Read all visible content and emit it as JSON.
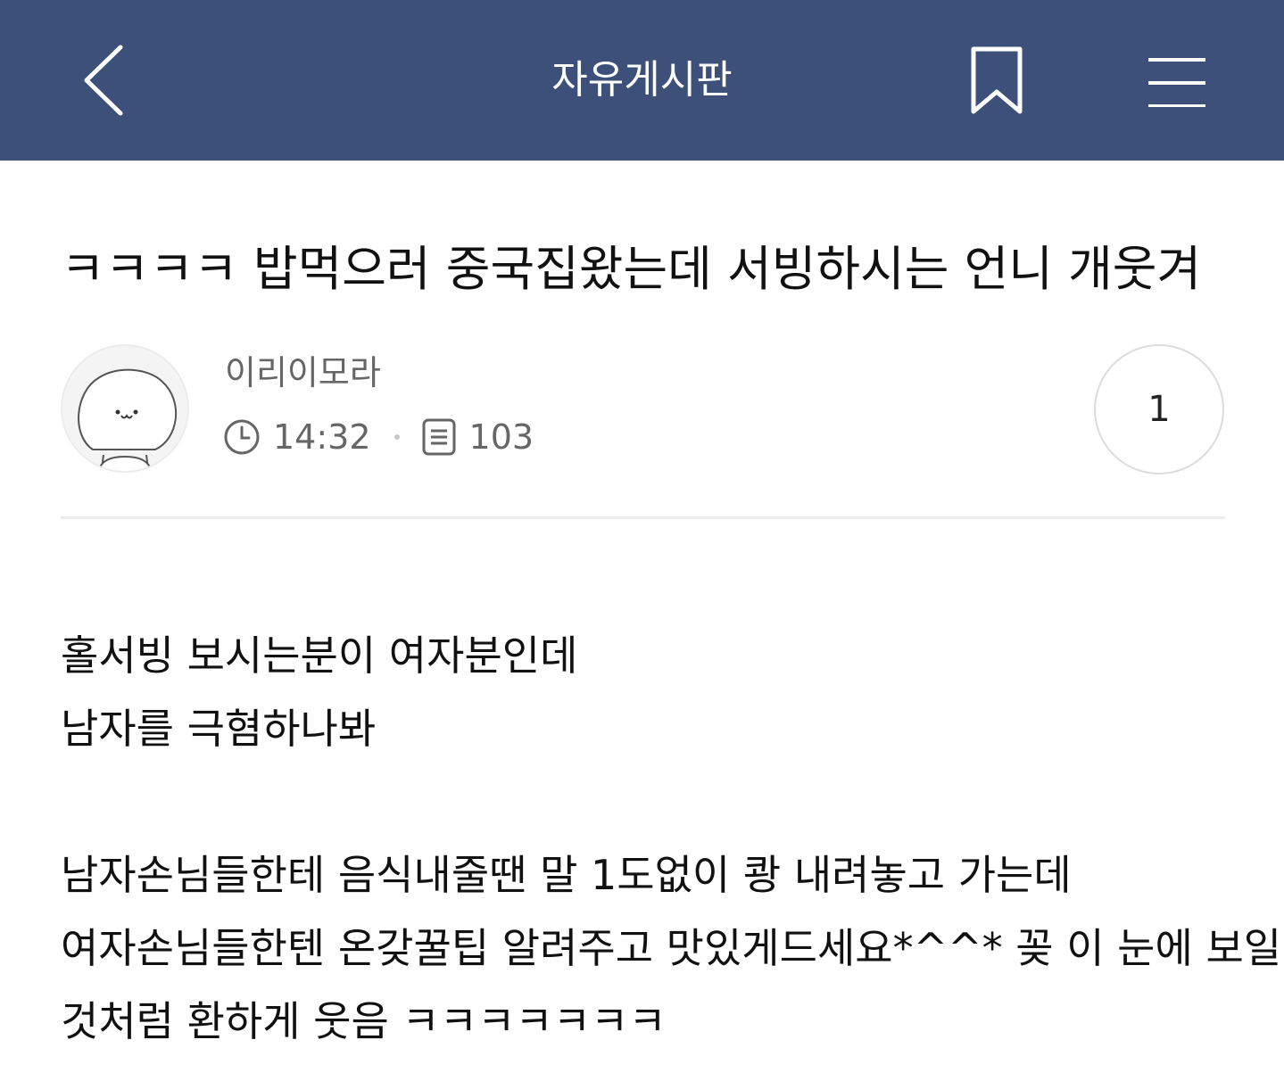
{
  "header": {
    "title": "자유게시판",
    "back_icon": "chevron-left-icon",
    "bookmark_icon": "bookmark-icon",
    "menu_icon": "hamburger-menu-icon",
    "background_color": "#3d5079"
  },
  "post": {
    "title": "ㅋㅋㅋㅋ 밥먹으러 중국집왔는데 서빙하시는 언니 개웃겨",
    "author": "이리이모라",
    "time": "14:32",
    "views": "103",
    "comment_count": "1",
    "body_lines": [
      "홀서빙 보시는분이 여자분인데",
      "남자를 극혐하나봐",
      "",
      "남자손님들한테 음식내줄땐 말 1도없이 쾅 내려놓고 가는데",
      "여자손님들한텐 온갖꿀팁 알려주고 맛있게드세요*^^* 꽂 이 눈에 보일",
      "것처럼 환하게 웃음 ㅋㅋㅋㅋㅋㅋㅋ"
    ]
  }
}
